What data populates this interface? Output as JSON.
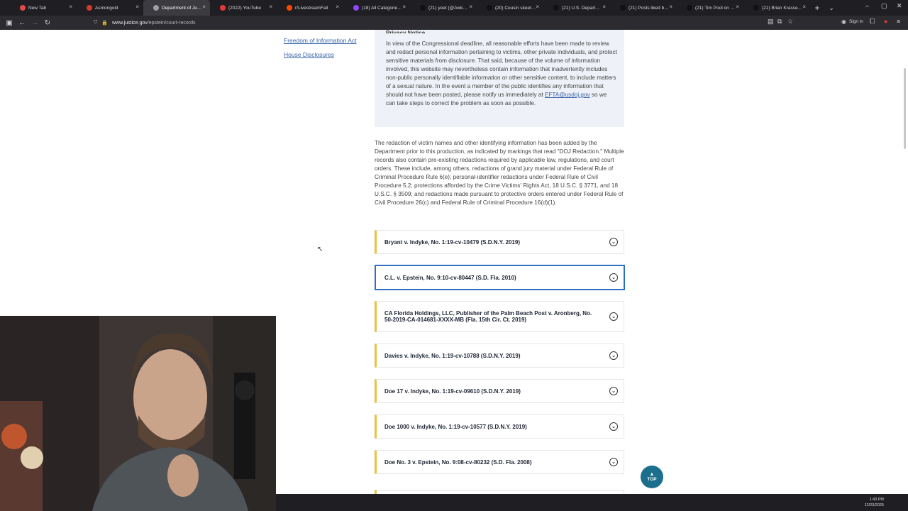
{
  "browser": {
    "tabs": [
      {
        "label": "New Tab",
        "color": "#e24a4a"
      },
      {
        "label": "Asmongold",
        "color": "#d23a2a"
      },
      {
        "label": "Department of Justice | E",
        "color": "#9aa0a6",
        "active": true
      },
      {
        "label": "(2022) YouTube",
        "color": "#e53935"
      },
      {
        "label": "r/LivestreamFail",
        "color": "#ff4500"
      },
      {
        "label": "(18) All Categories - Twitch",
        "color": "#9146ff"
      },
      {
        "label": "(21) yeet (@Awk20000) / X",
        "color": "#111111"
      },
      {
        "label": "(20) Cousin skeeter on X",
        "color": "#111111"
      },
      {
        "label": "(21) U.S. Department of",
        "color": "#111111"
      },
      {
        "label": "(21) Posts liked by Zack",
        "color": "#111111"
      },
      {
        "label": "(21) Tim Pool on X: \"We",
        "color": "#111111"
      },
      {
        "label": "(21) Brian Krassenstein o",
        "color": "#111111"
      }
    ],
    "close_glyph": "×",
    "new_tab_glyph": "+",
    "tab_list_glyph": "⌄",
    "window_controls": [
      "–",
      "▢",
      "✕"
    ],
    "url_host": "www.justice.gov",
    "url_path": "/epstein/court-records",
    "sign_in": "Sign in"
  },
  "left_nav": {
    "links": [
      "Freedom of Information Act",
      "House Disclosures"
    ]
  },
  "notice": {
    "title": "Privacy Notice",
    "body_before": "In view of the Congressional deadline, all reasonable efforts have been made to review and redact personal information pertaining to victims, other private individuals, and protect sensitive materials from disclosure. That said, because of the volume of information involved, this website may nevertheless contain information that inadvertently includes non-public personally identifiable information or other sensitive content, to include matters of a sexual nature. In the event a member of the public identifies any information that should not have been posted, please notify us immediately at ",
    "email": "EFTA@usdoj.gov",
    "body_after": " so we can take steps to correct the problem as soon as possible."
  },
  "redaction_paragraph": "The redaction of victim names and other identifying information has been added by the Department prior to this production, as indicated by markings that read \"DOJ Redaction.\" Multiple records also contain pre-existing redactions required by applicable law, regulations, and court orders. These include, among others, redactions of grand jury material under Federal Rule of Criminal Procedure Rule 6(e); personal-identifier redactions under Federal Rule of Civil Procedure 5.2; protections afforded by the Crime Victims' Rights Act, 18 U.S.C. § 3771, and 18 U.S.C. § 3509; and redactions made pursuant to protective orders entered under Federal Rule of Civil Procedure 26(c) and Federal Rule of Criminal Procedure 16(d)(1).",
  "cases": [
    "Bryant v. Indyke, No. 1:19-cv-10479 (S.D.N.Y. 2019)",
    "C.L. v. Epstein, No. 9:10-cv-80447 (S.D. Fla. 2010)",
    "CA Florida Holdings, LLC, Publisher of the Palm Beach Post v. Aronberg, No. 50-2019-CA-014681-XXXX-MB (Fla. 15th Cir. Ct. 2019)",
    "Davies v. Indyke, No. 1:19-cv-10788 (S.D.N.Y. 2019)",
    "Doe 17 v. Indyke, No. 1:19-cv-09610 (S.D.N.Y. 2019)",
    "Doe 1000 v. Indyke, No. 1:19-cv-10577 (S.D.N.Y. 2019)",
    "Doe No. 3 v. Epstein, No. 9:08-cv-80232 (S.D. Fla. 2008)"
  ],
  "top_button": {
    "arrow": "▲",
    "label": "TOP"
  },
  "clock": {
    "time": "1:43 PM",
    "date": "12/23/2025"
  },
  "colors": {
    "accent_yellow": "#e8c145",
    "focus_blue": "#2f6fc2",
    "link": "#3a64a8",
    "top_button": "#1b6e8c"
  }
}
